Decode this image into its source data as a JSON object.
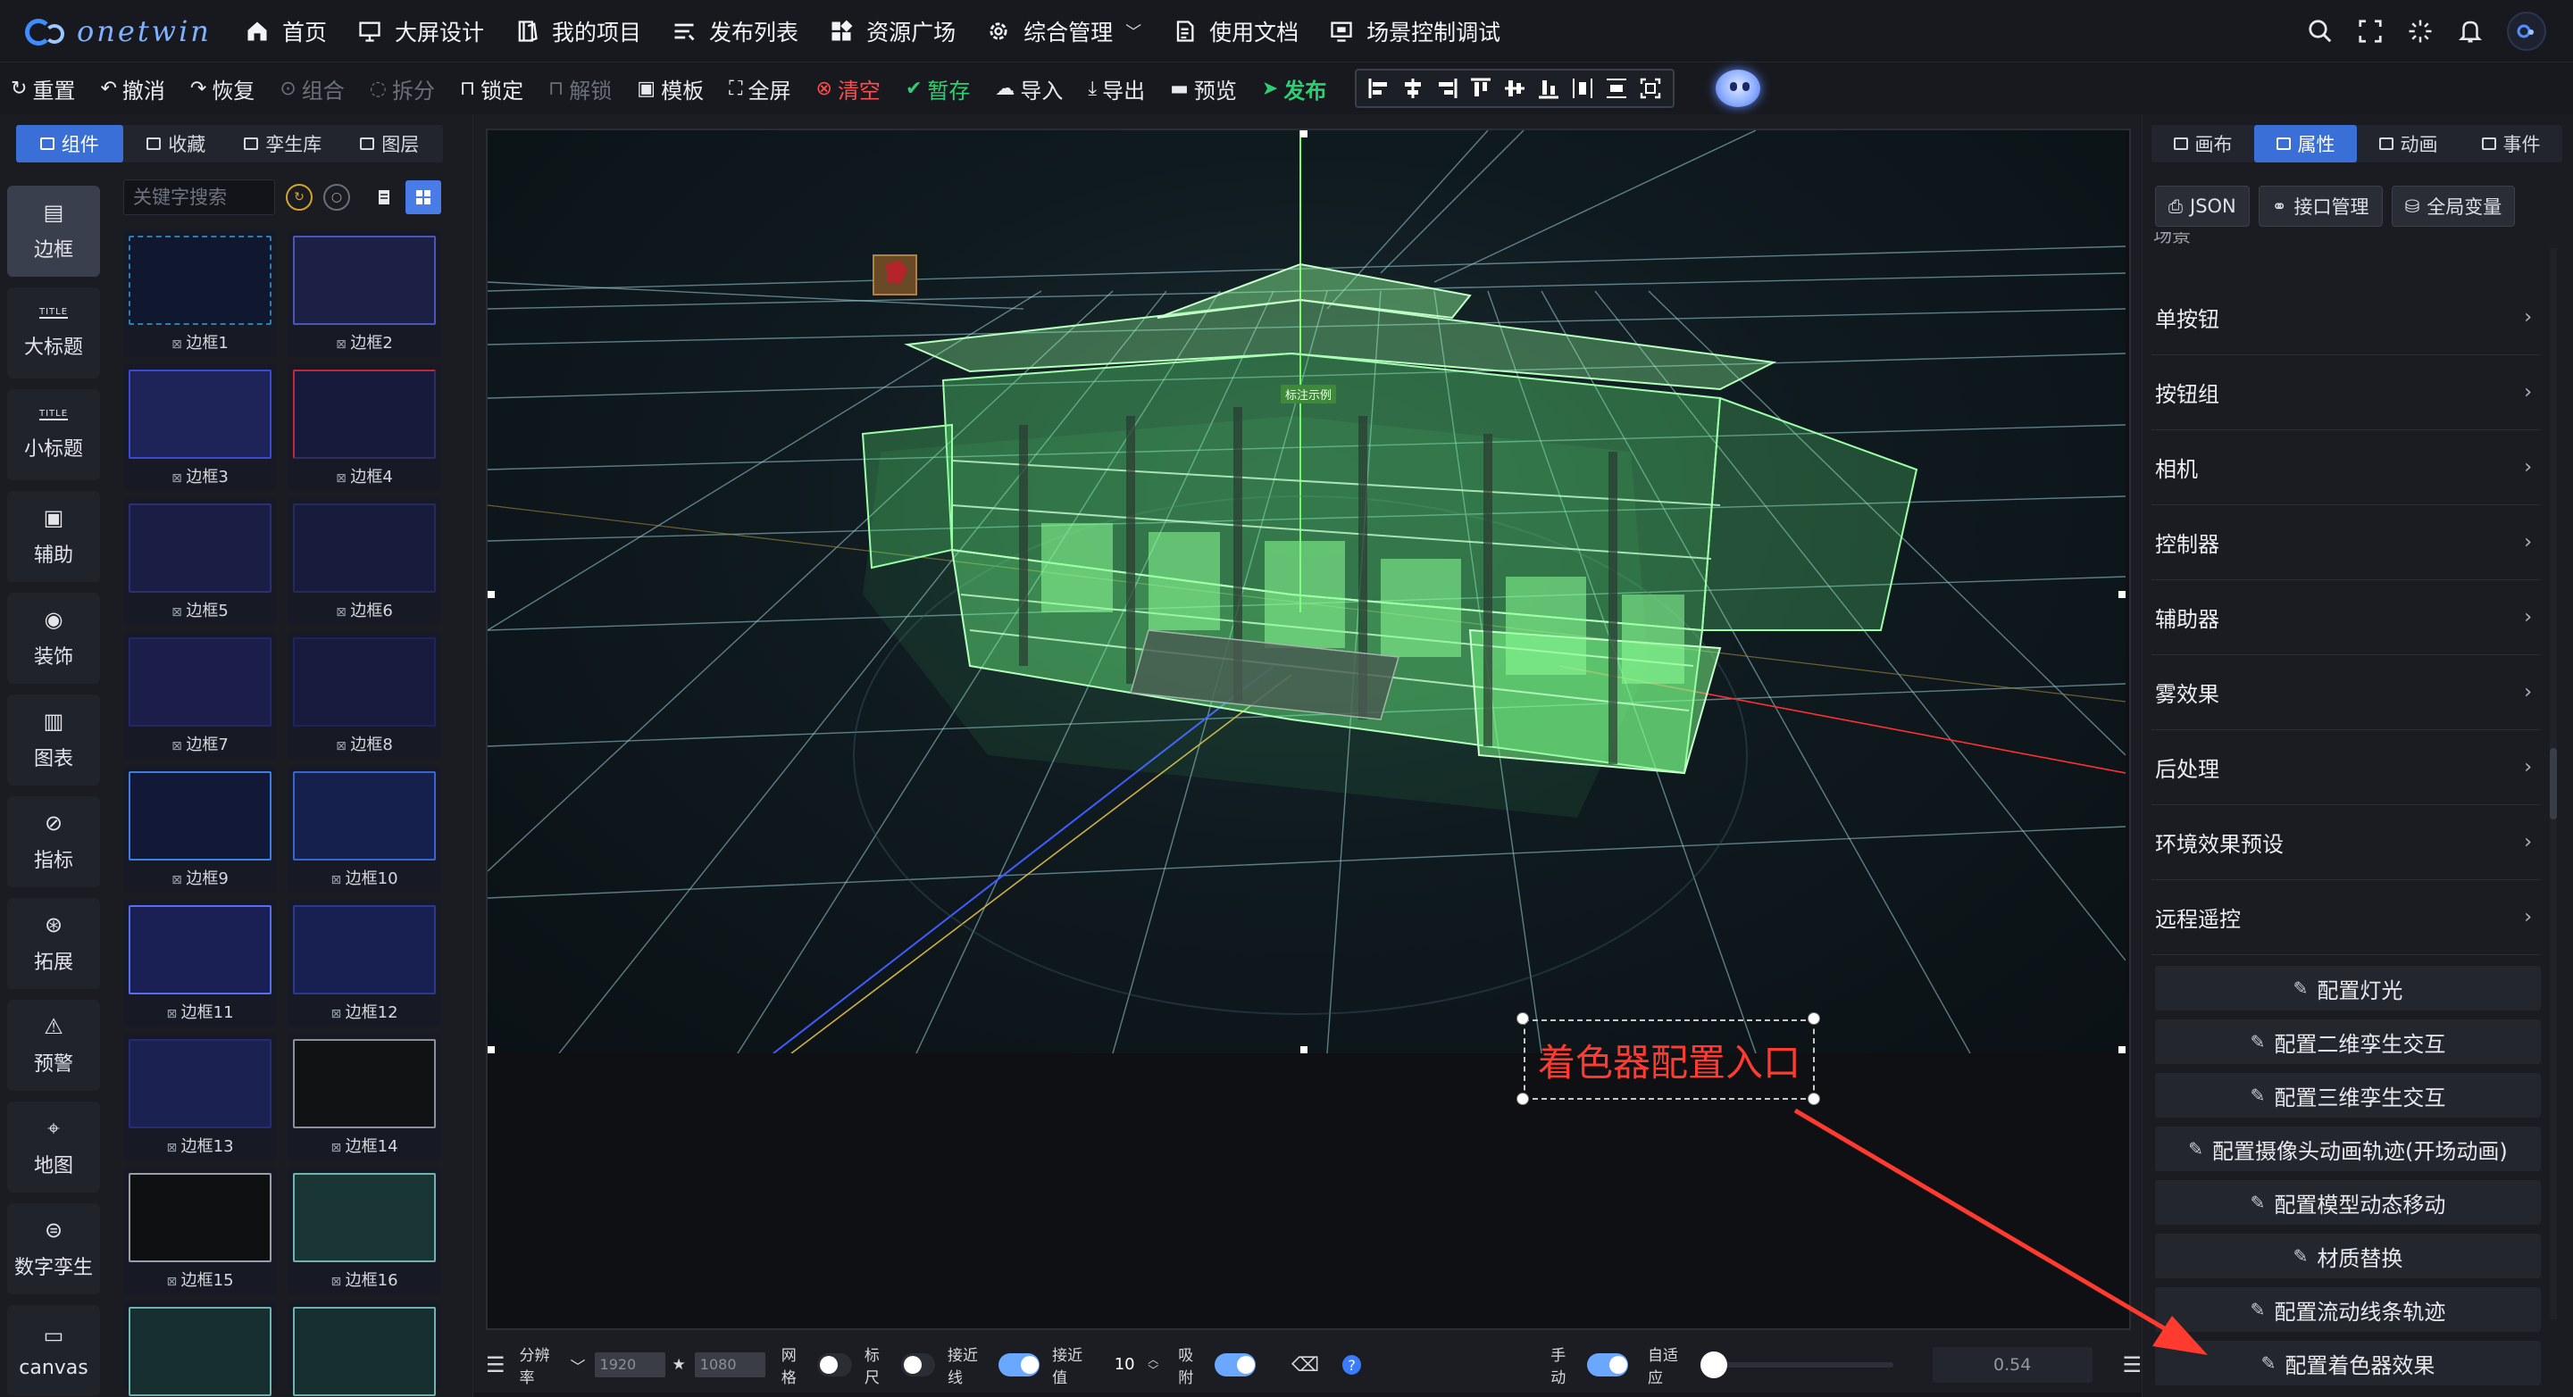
{
  "app": {
    "brand": "onetwin"
  },
  "nav": {
    "items": [
      {
        "label": "首页",
        "icon": "home-icon"
      },
      {
        "label": "大屏设计",
        "icon": "monitor-icon"
      },
      {
        "label": "我的项目",
        "icon": "book-icon"
      },
      {
        "label": "发布列表",
        "icon": "list-icon"
      },
      {
        "label": "资源广场",
        "icon": "apps-icon"
      },
      {
        "label": "综合管理",
        "icon": "gear-icon"
      },
      {
        "label": "使用文档",
        "icon": "doc-icon"
      },
      {
        "label": "场景控制调试",
        "icon": "screen-icon"
      }
    ]
  },
  "toolbar": {
    "reset": "重置",
    "undo": "撤消",
    "redo": "恢复",
    "group": "组合",
    "ungroup": "拆分",
    "lock": "锁定",
    "unlock": "解锁",
    "template": "模板",
    "fullscreen": "全屏",
    "clear": "清空",
    "save_draft": "暂存",
    "import": "导入",
    "export": "导出",
    "preview": "预览",
    "publish": "发布"
  },
  "left": {
    "tabs": [
      "组件",
      "收藏",
      "孪生库",
      "图层"
    ],
    "search_placeholder": "关键字搜索",
    "categories": [
      {
        "label": "边框",
        "icon": "frame-icon"
      },
      {
        "label": "大标题",
        "icon": "title-icon",
        "tiny": "TITLE"
      },
      {
        "label": "小标题",
        "icon": "subtitle-icon",
        "tiny": "TITLE"
      },
      {
        "label": "辅助",
        "icon": "aux-icon"
      },
      {
        "label": "装饰",
        "icon": "decor-icon"
      },
      {
        "label": "图表",
        "icon": "chart-icon"
      },
      {
        "label": "指标",
        "icon": "indicator-icon"
      },
      {
        "label": "拓展",
        "icon": "extend-icon"
      },
      {
        "label": "预警",
        "icon": "alarm-icon"
      },
      {
        "label": "地图",
        "icon": "map-icon"
      },
      {
        "label": "数字孪生",
        "icon": "twin-icon"
      },
      {
        "label": "canvas",
        "icon": "canvas-icon"
      }
    ],
    "components": [
      "边框1",
      "边框2",
      "边框3",
      "边框4",
      "边框5",
      "边框6",
      "边框7",
      "边框8",
      "边框9",
      "边框10",
      "边框11",
      "边框12",
      "边框13",
      "边框14",
      "边框15",
      "边框16"
    ]
  },
  "scene": {
    "tag_label": "标注示例",
    "annotation": "着色器配置入口"
  },
  "status": {
    "resolution_label": "分辨率",
    "width": "1920",
    "height": "1080",
    "grid_label": "网格",
    "ruler_label": "标尺",
    "snapline_label": "接近线",
    "snapvalue_label": "接近值",
    "snapvalue": "10",
    "attach_label": "吸附",
    "manual_label": "手动",
    "auto_label": "自适应",
    "zoom": "0.54"
  },
  "right": {
    "tabs": [
      "画布",
      "属性",
      "动画",
      "事件"
    ],
    "buttons": [
      "JSON",
      "接口管理",
      "全局变量"
    ],
    "partial": "场景",
    "sections": [
      "单按钮",
      "按钮组",
      "相机",
      "控制器",
      "辅助器",
      "雾效果",
      "后处理",
      "环境效果预设",
      "远程遥控"
    ],
    "configs": [
      "配置灯光",
      "配置二维孪生交互",
      "配置三维孪生交互",
      "配置摄像头动画轨迹(开场动画)",
      "配置模型动态移动",
      "材质替换",
      "配置流动线条轨迹",
      "配置着色器效果"
    ]
  },
  "colors": {
    "accent": "#3a6fd8",
    "danger": "#ff4d4f",
    "success": "#2ecf74",
    "annotation": "#ff3b30",
    "model_glow": "#7dff8a"
  }
}
